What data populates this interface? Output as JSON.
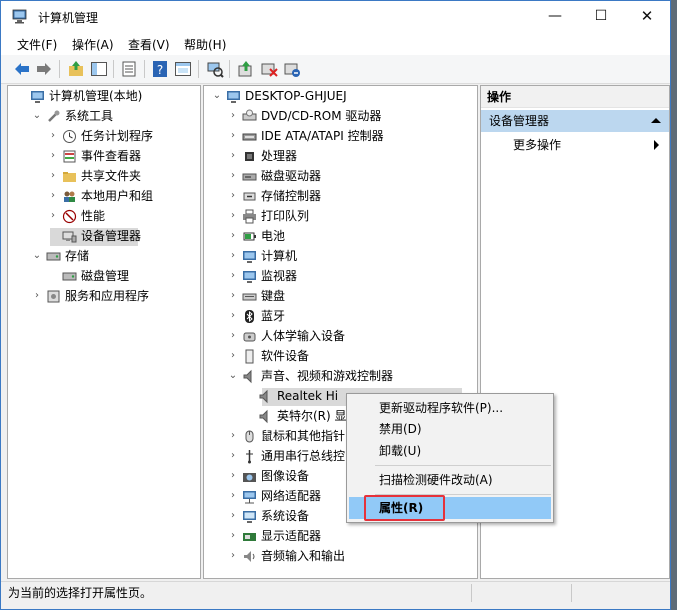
{
  "window": {
    "title": "计算机管理",
    "minimize": "—",
    "maximize": "☐",
    "close": "✕"
  },
  "menu": [
    "文件(F)",
    "操作(A)",
    "查看(V)",
    "帮助(H)"
  ],
  "toolbar_icons": [
    "back-arrow-icon",
    "forward-arrow-icon",
    "up-folder-icon",
    "show-hide-tree-icon",
    "properties-icon",
    "help-icon",
    "help-topics-icon",
    "scan-hardware-icon",
    "update-driver-icon",
    "disable-device-icon",
    "uninstall-device-icon"
  ],
  "left_tree": [
    {
      "label": "计算机管理(本地)",
      "level": 0,
      "expander": "",
      "icon": "computer-management-icon"
    },
    {
      "label": "系统工具",
      "level": 1,
      "expander": "⌄",
      "icon": "tools-icon"
    },
    {
      "label": "任务计划程序",
      "level": 2,
      "expander": "›",
      "icon": "clock-icon"
    },
    {
      "label": "事件查看器",
      "level": 2,
      "expander": "›",
      "icon": "event-viewer-icon"
    },
    {
      "label": "共享文件夹",
      "level": 2,
      "expander": "›",
      "icon": "shared-folder-icon"
    },
    {
      "label": "本地用户和组",
      "level": 2,
      "expander": "›",
      "icon": "users-icon"
    },
    {
      "label": "性能",
      "level": 2,
      "expander": "›",
      "icon": "performance-icon"
    },
    {
      "label": "设备管理器",
      "level": 2,
      "expander": "",
      "icon": "device-manager-icon",
      "selected": true
    },
    {
      "label": "存储",
      "level": 1,
      "expander": "⌄",
      "icon": "storage-icon"
    },
    {
      "label": "磁盘管理",
      "level": 2,
      "expander": "",
      "icon": "disk-management-icon"
    },
    {
      "label": "服务和应用程序",
      "level": 1,
      "expander": "›",
      "icon": "services-icon"
    }
  ],
  "device_tree": [
    {
      "label": "DESKTOP-GHJUEJ",
      "level": 0,
      "expander": "⌄",
      "icon": "computer-icon"
    },
    {
      "label": "DVD/CD-ROM 驱动器",
      "level": 1,
      "expander": "›",
      "icon": "dvd-drive-icon"
    },
    {
      "label": "IDE ATA/ATAPI 控制器",
      "level": 1,
      "expander": "›",
      "icon": "ide-controller-icon"
    },
    {
      "label": "处理器",
      "level": 1,
      "expander": "›",
      "icon": "processor-icon"
    },
    {
      "label": "磁盘驱动器",
      "level": 1,
      "expander": "›",
      "icon": "disk-drive-icon"
    },
    {
      "label": "存储控制器",
      "level": 1,
      "expander": "›",
      "icon": "storage-controller-icon"
    },
    {
      "label": "打印队列",
      "level": 1,
      "expander": "›",
      "icon": "printer-icon"
    },
    {
      "label": "电池",
      "level": 1,
      "expander": "›",
      "icon": "battery-icon"
    },
    {
      "label": "计算机",
      "level": 1,
      "expander": "›",
      "icon": "monitor-icon"
    },
    {
      "label": "监视器",
      "level": 1,
      "expander": "›",
      "icon": "monitor-icon"
    },
    {
      "label": "键盘",
      "level": 1,
      "expander": "›",
      "icon": "keyboard-icon"
    },
    {
      "label": "蓝牙",
      "level": 1,
      "expander": "›",
      "icon": "bluetooth-icon"
    },
    {
      "label": "人体学输入设备",
      "level": 1,
      "expander": "›",
      "icon": "hid-icon"
    },
    {
      "label": "软件设备",
      "level": 1,
      "expander": "›",
      "icon": "software-device-icon"
    },
    {
      "label": "声音、视频和游戏控制器",
      "level": 1,
      "expander": "⌄",
      "icon": "speaker-icon"
    },
    {
      "label": "Realtek Hi",
      "level": 2,
      "expander": "",
      "icon": "speaker-icon",
      "selected": true
    },
    {
      "label": "英特尔(R) 显",
      "level": 2,
      "expander": "",
      "icon": "speaker-icon"
    },
    {
      "label": "鼠标和其他指针",
      "level": 1,
      "expander": "›",
      "icon": "mouse-icon"
    },
    {
      "label": "通用串行总线控",
      "level": 1,
      "expander": "›",
      "icon": "usb-icon"
    },
    {
      "label": "图像设备",
      "level": 1,
      "expander": "›",
      "icon": "camera-icon"
    },
    {
      "label": "网络适配器",
      "level": 1,
      "expander": "›",
      "icon": "network-adapter-icon"
    },
    {
      "label": "系统设备",
      "level": 1,
      "expander": "›",
      "icon": "system-device-icon"
    },
    {
      "label": "显示适配器",
      "level": 1,
      "expander": "›",
      "icon": "display-adapter-icon"
    },
    {
      "label": "音频输入和输出",
      "level": 1,
      "expander": "›",
      "icon": "audio-io-icon"
    }
  ],
  "actions_pane": {
    "header": "操作",
    "section": "设备管理器",
    "more": "更多操作"
  },
  "context_menu": {
    "items": [
      "更新驱动程序软件(P)...",
      "禁用(D)",
      "卸载(U)",
      "扫描检测硬件改动(A)",
      "属性(R)"
    ],
    "highlighted": "属性(R)"
  },
  "status": "为当前的选择打开属性页。",
  "colors": {
    "selection": "#91c9f7",
    "actions_selected": "#bcd7ef",
    "highlight_box": "#e5323b",
    "accent": "#3b79c4"
  }
}
